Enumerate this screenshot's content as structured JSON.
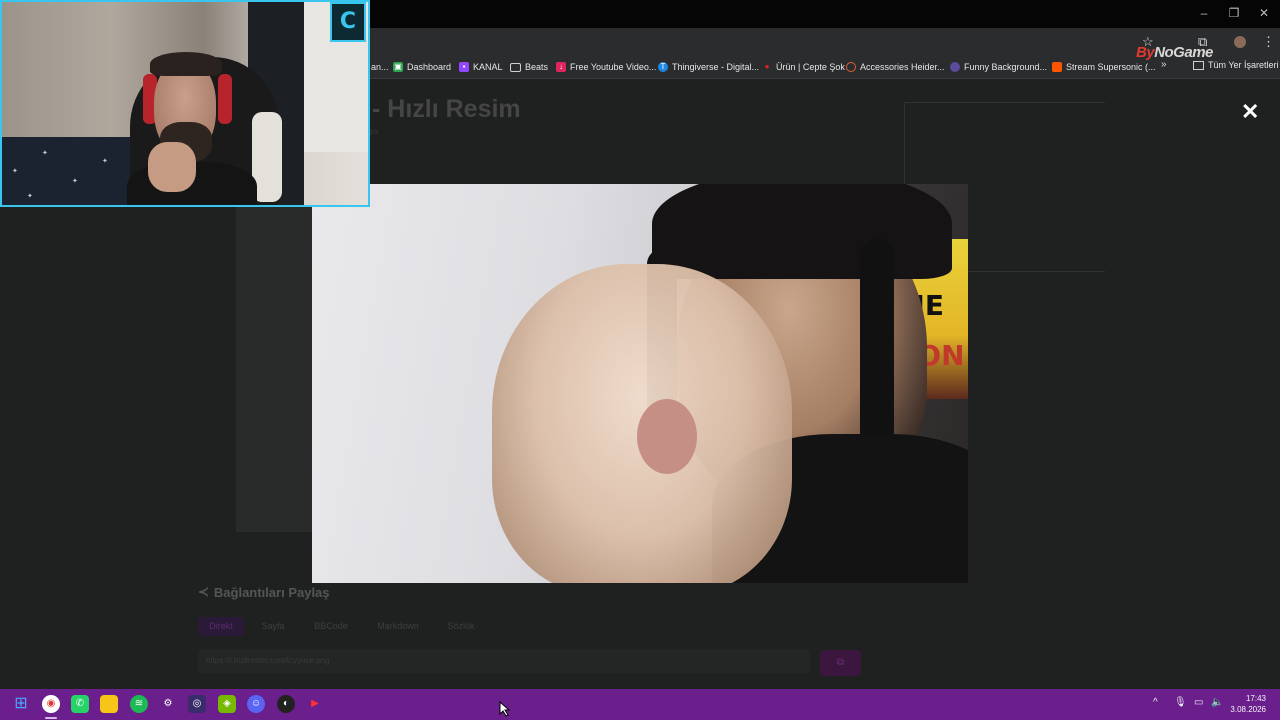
{
  "window": {
    "minimize": "–",
    "restore": "❐",
    "close": "✕"
  },
  "toolbar": {
    "star_icon": "☆",
    "extensions_icon": "⧉",
    "menu_icon": "⋮"
  },
  "bookmarks": [
    {
      "label": "an...",
      "icon": "partial"
    },
    {
      "label": "Dashboard",
      "icon": "dashboard-icon",
      "color": "#2ea44f"
    },
    {
      "label": "KANAL",
      "icon": "twitch-icon",
      "color": "#9146ff"
    },
    {
      "label": "Beats",
      "icon": "folder-icon",
      "color": "#cfcfcf"
    },
    {
      "label": "Free Youtube Video...",
      "icon": "download-icon",
      "color": "#e0245e"
    },
    {
      "label": "Thingiverse - Digital...",
      "icon": "thingiverse-icon",
      "color": "#1e88e5"
    },
    {
      "label": "Ürün | Cepte Şok",
      "icon": "sok-icon",
      "color": "#e02020"
    },
    {
      "label": "Accessories Heider...",
      "icon": "circle-icon",
      "color": "#e0612f"
    },
    {
      "label": "Funny Background...",
      "icon": "shape-icon",
      "color": "#5c4b9b"
    },
    {
      "label": "Stream Supersonic (...",
      "icon": "soundcloud-icon",
      "color": "#ff5500"
    }
  ],
  "bookmarks_more": "»",
  "bookmarks_all": "Tüm Yer İşaretleri",
  "page": {
    "title": "- Hızlı Resim",
    "subtitle": "px",
    "share_title": "Bağlantıları Paylaş",
    "share_tabs": [
      "Direkt",
      "Sayfa",
      "BBCode",
      "Markdown",
      "Sözlük"
    ],
    "share_url": "https://i.hizliresim.com/tcyyuce.png",
    "copy_icon": "⧉"
  },
  "lightbox": {
    "close_icon": "✕",
    "poster_text_1": "ME",
    "poster_text_2": "ZON"
  },
  "overlay": {
    "brand_prefix": "By",
    "brand_name": "NoGame",
    "cam_logo": "C"
  },
  "taskbar": {
    "time": "17:43",
    "date": "3.08.2026",
    "tray_up": "^",
    "mic_icon": "🎙",
    "display_icon": "▭",
    "volume_icon": "🔈"
  }
}
